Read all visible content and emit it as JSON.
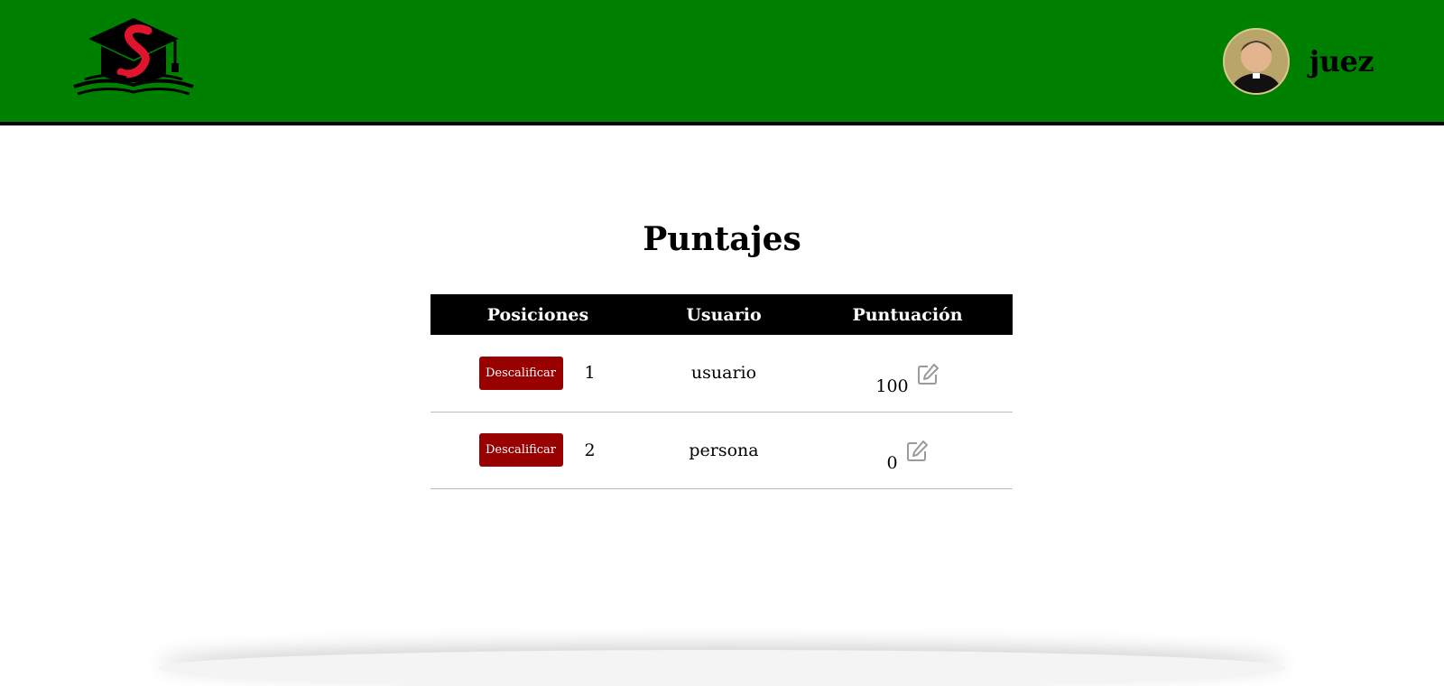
{
  "header": {
    "logo_icon": "graduation-cap-book-logo",
    "username": "juez",
    "colors": {
      "bar": "#008000",
      "accent": "#e0142d"
    }
  },
  "main": {
    "title": "Puntajes",
    "table": {
      "columns": [
        "Posiciones",
        "Usuario",
        "Puntuación"
      ],
      "rows": [
        {
          "action_label": "Descalificar",
          "position": "1",
          "user": "usuario",
          "score": "100"
        },
        {
          "action_label": "Descalificar",
          "position": "2",
          "user": "persona",
          "score": "0"
        }
      ]
    },
    "colors": {
      "disqualify_button": "#990000",
      "header_row": "#000000"
    }
  }
}
